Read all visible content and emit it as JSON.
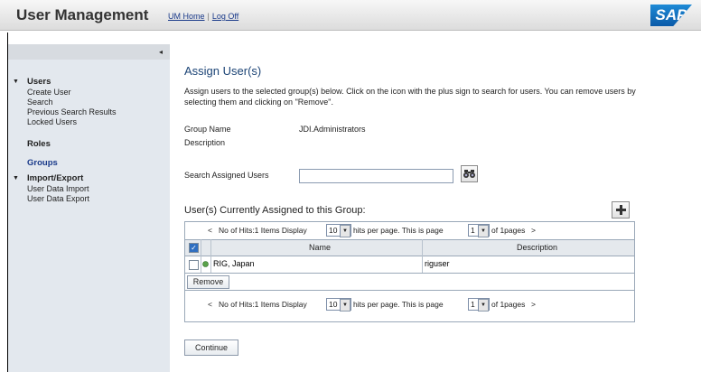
{
  "header": {
    "title": "User Management",
    "links": [
      "UM Home",
      "Log Off"
    ],
    "logo_text": "SAP"
  },
  "sidebar": {
    "collapse_icon": "◂",
    "sections": [
      {
        "label": "Users",
        "expanded": true,
        "items": [
          "Create User",
          "Search",
          "Previous Search Results",
          "Locked Users"
        ]
      },
      {
        "label": "Roles"
      },
      {
        "label": "Groups",
        "selected": true
      },
      {
        "label": "Import/Export",
        "expanded": true,
        "items": [
          "User Data Import",
          "User Data Export"
        ]
      }
    ]
  },
  "main": {
    "heading": "Assign User(s)",
    "intro": "Assign users to the selected group(s) below. Click on the icon with the plus sign to search for users. You can remove users by selecting them and clicking on \"Remove\".",
    "group_name_label": "Group Name",
    "group_name_value": "JDI.Administrators",
    "description_label": "Description",
    "search_label": "Search Assigned Users",
    "search_value": "",
    "assigned_title": "User(s) Currently Assigned to this Group:",
    "pager": {
      "prev": "<",
      "hits_text": "No of Hits:1 Items  Display",
      "per_page": "10",
      "per_page_text": "hits per page. This is page",
      "page": "1",
      "of_pages": "of 1pages",
      "next": ">"
    },
    "table": {
      "columns": [
        "Name",
        "Description"
      ],
      "rows": [
        {
          "name": "RIG, Japan",
          "description": "riguser"
        }
      ]
    },
    "remove_label": "Remove",
    "continue_label": "Continue"
  },
  "colors": {
    "heading": "#1c4476",
    "sidebar_bg": "#e3e8ee",
    "selected_nav": "#1a3a8a"
  }
}
